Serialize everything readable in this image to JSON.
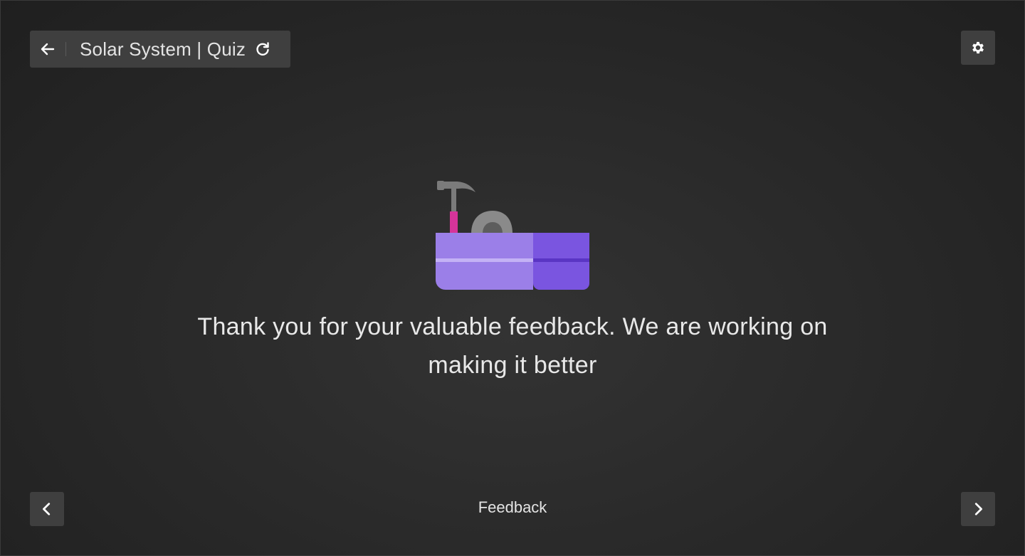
{
  "header": {
    "title": "Solar System | Quiz",
    "back_icon": "arrow-left-icon",
    "refresh_icon": "refresh-icon"
  },
  "settings": {
    "icon": "gear-icon"
  },
  "main": {
    "illustration": "toolbox-icon",
    "message": "Thank you for your valuable feedback. We are working on making it better"
  },
  "footer": {
    "label": "Feedback",
    "prev_icon": "chevron-left-icon",
    "next_icon": "chevron-right-icon"
  },
  "colors": {
    "background": "#2a2a2a",
    "panel": "#3f3f3f",
    "text": "#e6e6e6",
    "accent_purple": "#9b7fe8",
    "accent_purple_dark": "#7a55e0",
    "hammer_handle": "#d6349a"
  }
}
